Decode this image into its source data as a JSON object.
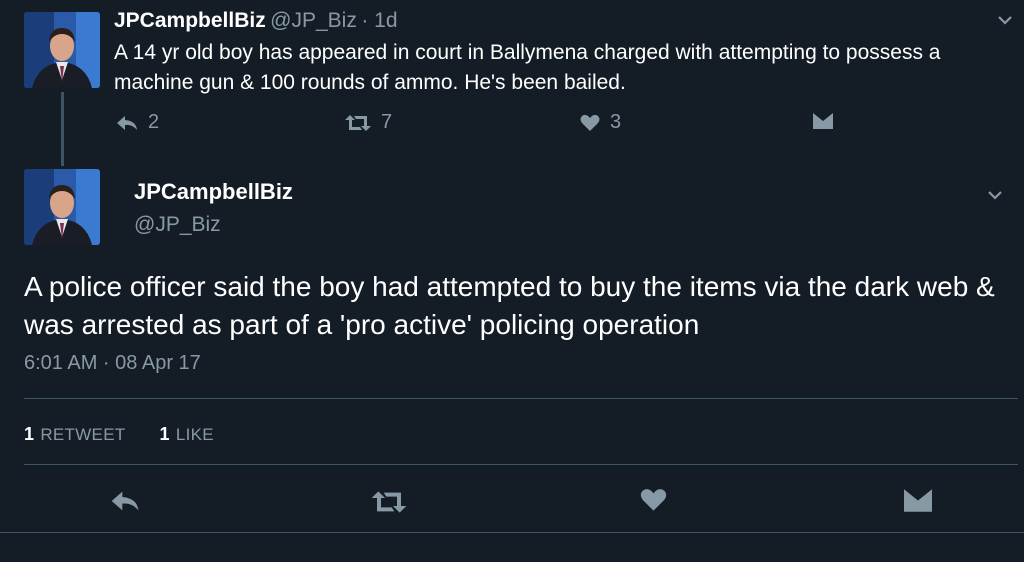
{
  "tweet1": {
    "name": "JPCampbellBiz",
    "handle": "@JP_Biz",
    "time": "· 1d",
    "text": "A 14 yr old boy has appeared in court in Ballymena charged with attempting to possess a machine gun & 100 rounds of ammo. He's been bailed.",
    "reply_count": "2",
    "retweet_count": "7",
    "like_count": "3"
  },
  "tweet2": {
    "name": "JPCampbellBiz",
    "handle": "@JP_Biz",
    "text": "A police officer said the boy had attempted to buy the items via the dark web & was arrested as part of a 'pro active' policing operation",
    "timestamp": "6:01 AM · 08 Apr 17",
    "retweets_count": "1",
    "retweets_label": "RETWEET",
    "likes_count": "1",
    "likes_label": "LIKE"
  },
  "icons": {
    "reply": "reply-icon",
    "retweet": "retweet-icon",
    "like": "heart-icon",
    "message": "envelope-icon",
    "menu": "chevron-down-icon"
  },
  "colors": {
    "background": "#141d26",
    "secondary_text": "#8899a6",
    "divider": "#3d5466"
  }
}
